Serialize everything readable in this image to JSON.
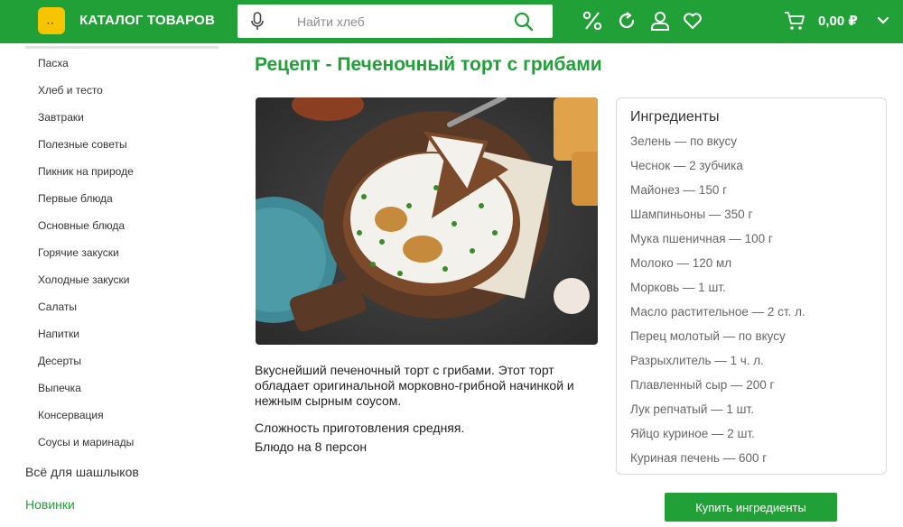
{
  "header": {
    "catalog_title": "КАТАЛОГ ТОВАРОВ",
    "search_placeholder": "Найти хлеб",
    "cart_total": "0,00 ₽",
    "icons": [
      "mic-icon",
      "search-icon",
      "percent-icon",
      "refresh-icon",
      "user-icon",
      "heart-icon",
      "cart-icon",
      "chevron-down-icon"
    ]
  },
  "sidebar": {
    "items": [
      "Пасха",
      "Хлеб и тесто",
      "Завтраки",
      "Полезные советы",
      "Пикник на природе",
      "Первые блюда",
      "Основные блюда",
      "Горячие закуски",
      "Холодные закуски",
      "Салаты",
      "Напитки",
      "Десерты",
      "Выпечка",
      "Консервация",
      "Соусы и маринады"
    ],
    "all_for_bbq": "Всё для шашлыков",
    "new": "Новинки"
  },
  "recipe": {
    "title": "Рецепт - Печеночный торт с грибами",
    "description": "Вкуснейший печеночный торт с грибами. Этот торт обладает оригинальной морковно-грибной начинкой и нежным сырным соусом.",
    "difficulty": "Сложность приготовления средняя.",
    "servings": "Блюдо на 8 персон"
  },
  "ingredients": {
    "title": "Ингредиенты",
    "items": [
      "Зелень — по вкусу",
      "Чеснок — 2 зубчика",
      "Майонез — 150 г",
      "Шампиньоны — 350 г",
      "Мука пшеничная — 100 г",
      "Молоко — 120 мл",
      "Морковь — 1 шт.",
      "Масло растительное — 2 ст. л.",
      "Перец молотый — по вкусу",
      "Разрыхлитель — 1 ч. л.",
      "Плавленный сыр — 200 г",
      "Лук репчатый — 1 шт.",
      "Яйцо куриное — 2 шт.",
      "Куриная печень — 600 г"
    ],
    "buy_label": "Купить ингредиенты"
  },
  "colors": {
    "brand_green": "#21a038",
    "logo_yellow": "#f7c400"
  }
}
